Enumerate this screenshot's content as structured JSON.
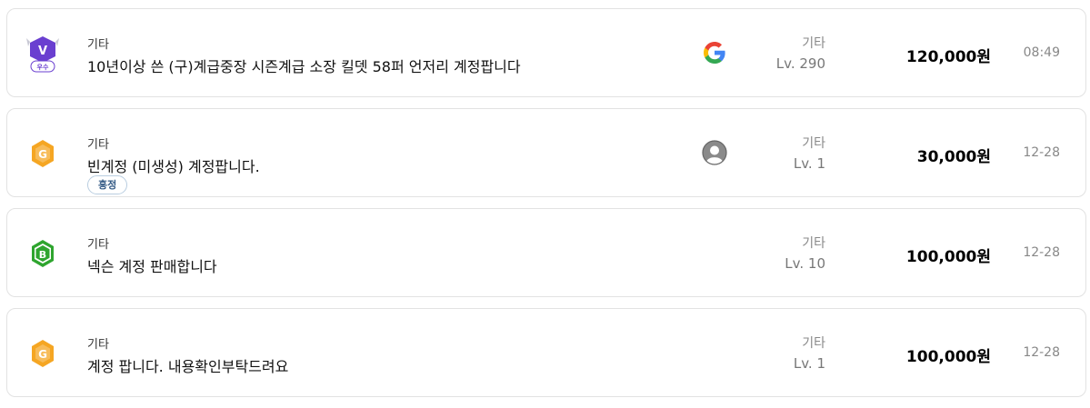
{
  "listings": [
    {
      "grade_icon": "grade-v-shield-icon",
      "grade_letter": "V",
      "grade_label": "우수",
      "category": "기타",
      "title": "10년이상 쓴 (구)계급중장 시즌계급 소장 킬뎃 58퍼 언저리 계정팝니다",
      "tag": null,
      "platform_icon": "google-icon",
      "level_category": "기타",
      "level": "Lv. 290",
      "price": "120,000원",
      "time": "08:49"
    },
    {
      "grade_icon": "grade-g-hexagon-icon",
      "grade_letter": "G",
      "category": "기타",
      "title": "빈계정 (미생성) 계정팝니다.",
      "tag": "흥정",
      "platform_icon": "default-avatar-icon",
      "level_category": "기타",
      "level": "Lv. 1",
      "price": "30,000원",
      "time": "12-28"
    },
    {
      "grade_icon": "grade-b-hexagon-icon",
      "grade_letter": "B",
      "category": "기타",
      "title": "넥슨 계정 판매합니다",
      "tag": null,
      "platform_icon": null,
      "level_category": "기타",
      "level": "Lv. 10",
      "price": "100,000원",
      "time": "12-28"
    },
    {
      "grade_icon": "grade-g-hexagon-icon",
      "grade_letter": "G",
      "category": "기타",
      "title": "계정 팝니다. 내용확인부탁드려요",
      "tag": null,
      "platform_icon": null,
      "level_category": "기타",
      "level": "Lv. 1",
      "price": "100,000원",
      "time": "12-28"
    }
  ],
  "colors": {
    "grade_v": "#6a3fd0",
    "grade_g": "#f5a623",
    "grade_b": "#2fa52f",
    "border": "#e2e2e2"
  }
}
